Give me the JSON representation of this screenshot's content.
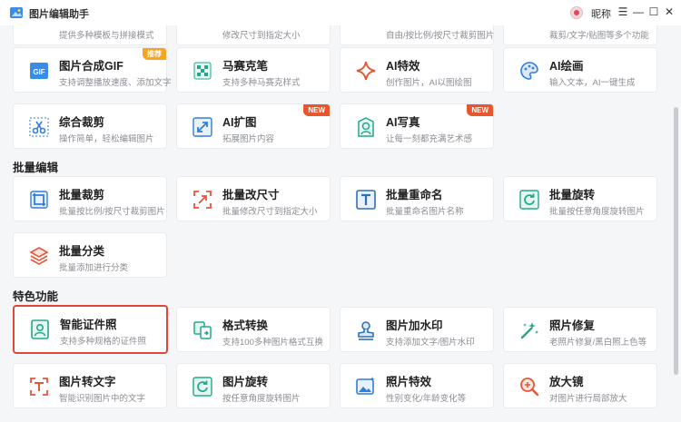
{
  "window": {
    "title": "图片编辑助手",
    "user_name": "昵称",
    "controls": [
      "☰",
      "—",
      "☐",
      "✕"
    ]
  },
  "partial_top": [
    "提供多种模板与拼接模式",
    "修改尺寸到指定大小",
    "自由/按比例/按尺寸裁剪图片",
    "裁剪/文字/贴图等多个功能"
  ],
  "sections": {
    "batch": "批量编辑",
    "featured": "特色功能"
  },
  "cards": {
    "gif": {
      "title": "图片合成GIF",
      "desc": "支持调整播放速度、添加文字",
      "badge": "推荐",
      "icon": "gif-icon"
    },
    "mosaic": {
      "title": "马赛克笔",
      "desc": "支持多种马赛克样式",
      "icon": "mosaic-icon"
    },
    "ai_effect": {
      "title": "AI特效",
      "desc": "创作图片，AI以图绘图",
      "icon": "sparkle-icon"
    },
    "ai_paint": {
      "title": "AI绘画",
      "desc": "输入文本，AI一键生成",
      "icon": "palette-icon"
    },
    "crop": {
      "title": "综合裁剪",
      "desc": "操作简单，轻松编辑图片",
      "icon": "scissors-icon"
    },
    "ai_expand": {
      "title": "AI扩图",
      "desc": "拓展图片内容",
      "badge": "NEW",
      "icon": "expand-icon"
    },
    "ai_portrait": {
      "title": "AI写真",
      "desc": "让每一刻都充满艺术感",
      "badge": "NEW",
      "icon": "portrait-icon"
    },
    "batch_crop": {
      "title": "批量裁剪",
      "desc": "批量按比例/按尺寸裁剪图片",
      "icon": "crop-icon"
    },
    "batch_resize": {
      "title": "批量改尺寸",
      "desc": "批量修改尺寸到指定大小",
      "icon": "resize-icon"
    },
    "batch_rename": {
      "title": "批量重命名",
      "desc": "批量重命名图片名称",
      "icon": "rename-icon"
    },
    "batch_rotate": {
      "title": "批量旋转",
      "desc": "批量按任意角度旋转图片",
      "icon": "rotate-icon"
    },
    "batch_classify": {
      "title": "批量分类",
      "desc": "批量添加进行分类",
      "icon": "layers-icon"
    },
    "id_photo": {
      "title": "智能证件照",
      "desc": "支持多种规格的证件照",
      "icon": "id-photo-icon"
    },
    "format": {
      "title": "格式转换",
      "desc": "支持100多种图片格式互换",
      "icon": "convert-icon"
    },
    "watermark": {
      "title": "图片加水印",
      "desc": "支持添加文字/图片水印",
      "icon": "stamp-icon"
    },
    "repair": {
      "title": "照片修复",
      "desc": "老照片修复/黑白照上色等",
      "icon": "magic-wand-icon"
    },
    "ocr": {
      "title": "图片转文字",
      "desc": "智能识别图片中的文字",
      "icon": "text-scan-icon"
    },
    "rotate": {
      "title": "图片旋转",
      "desc": "按任意角度旋转图片",
      "icon": "rotate-icon"
    },
    "effects": {
      "title": "照片特效",
      "desc": "性别变化/年龄变化等",
      "icon": "image-effect-icon"
    },
    "magnifier": {
      "title": "放大镜",
      "desc": "对图片进行局部放大",
      "icon": "magnifier-icon"
    }
  },
  "colors": {
    "accent_blue": "#2f7de1",
    "badge_new": "#e6572e",
    "badge_rec": "#f5a524",
    "selected_border": "#e0463a"
  }
}
